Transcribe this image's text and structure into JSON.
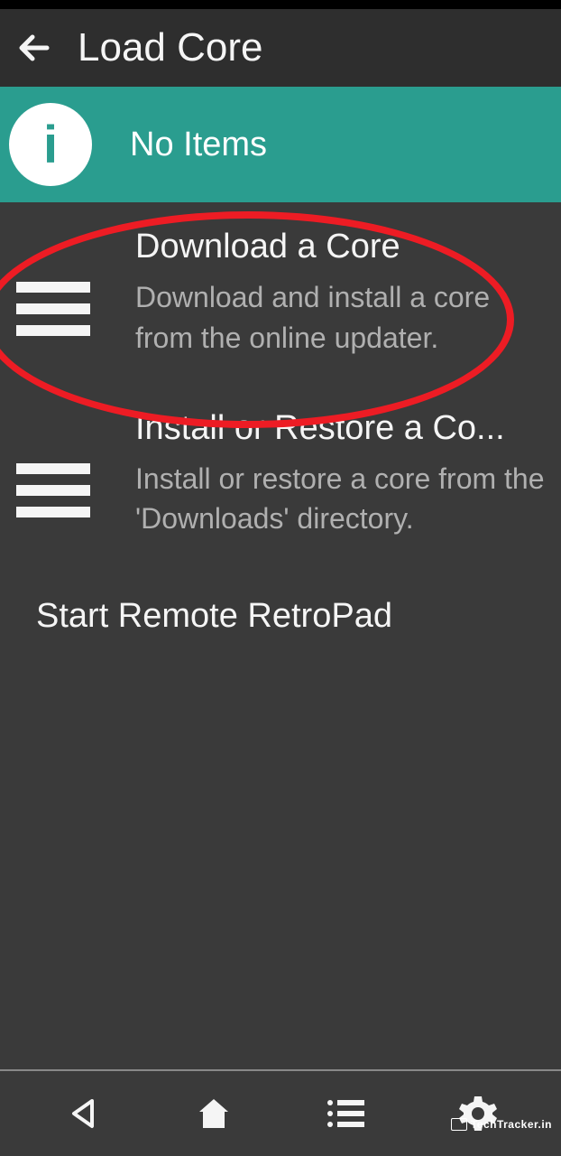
{
  "header": {
    "title": "Load Core"
  },
  "banner": {
    "icon_label": "i",
    "text": "No Items"
  },
  "menu": [
    {
      "title": "Download a Core",
      "description": "Download and install a core from the online updater.",
      "highlighted": true
    },
    {
      "title": "Install or Restore a Co...",
      "description": "Install or restore a core from the 'Downloads' directory.",
      "highlighted": false
    }
  ],
  "simple_item": "Start Remote RetroPad",
  "watermark": "TechTracker.in"
}
